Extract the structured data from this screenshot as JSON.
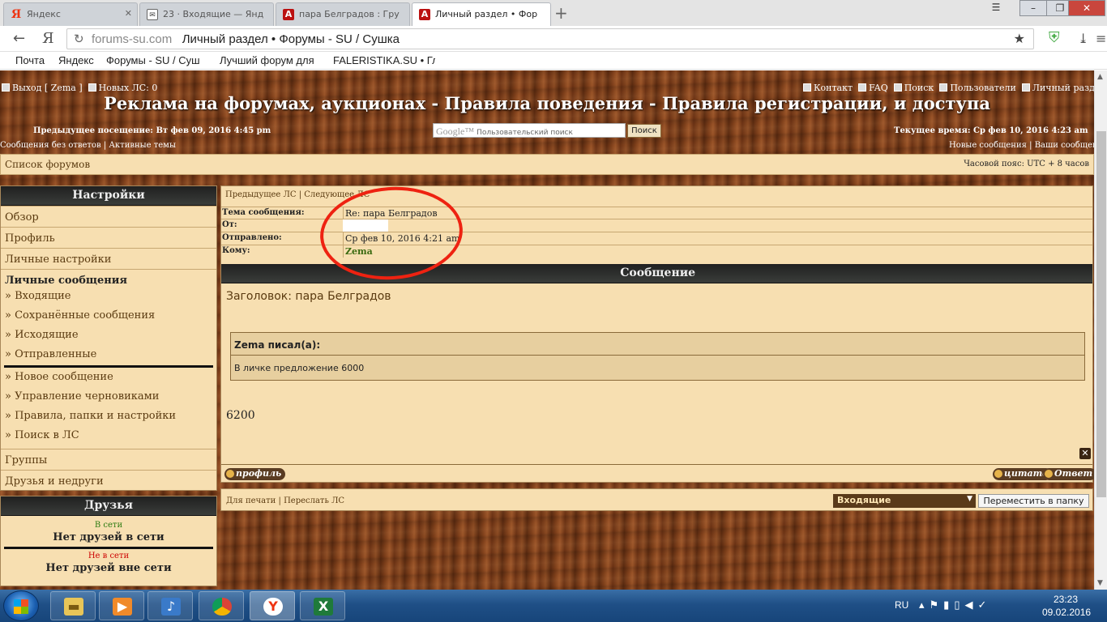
{
  "browser": {
    "tabs": [
      {
        "label": "Яндекс",
        "favicon": "yandex-icon"
      },
      {
        "label": "23 · Входящие — Янд",
        "favicon": "mail-icon"
      },
      {
        "label": "пара Белградов : Гру",
        "favicon": "forum-icon"
      },
      {
        "label": "Личный раздел • Фор",
        "favicon": "forum-icon",
        "active": true
      }
    ],
    "url_domain": "forums-su.com",
    "url_title": "Личный раздел • Форумы - SU / Сушка",
    "shield_badge": "4",
    "bookmarks": [
      "Почта",
      "Яндекс",
      "Форумы - SU / Суш",
      "Лучший форум для",
      "FALERISTIKA.SU • Гл"
    ]
  },
  "forum": {
    "top_left_logout": "Выход [ Zema ]",
    "top_left_pm": "Новых ЛС: 0",
    "top_right_links": [
      "Контакт",
      "FAQ",
      "Поиск",
      "Пользователи",
      "Личный раздел"
    ],
    "banner": "Реклама на форумах, аукционах - Правила поведения - Правила регистрации, и доступа",
    "last_visit": "Предыдущее посещение: Вт фев 09, 2016 4:45 pm",
    "current_time": "Текущее время: Ср фев 10, 2016 4:23 am",
    "search_brand": "Google™",
    "search_placeholder": "Пользовательский поиск",
    "search_button": "Поиск",
    "left_links": [
      "Сообщения без ответов",
      "Активные темы"
    ],
    "right_links": [
      "Новые сообщения",
      "Ваши сообщения"
    ],
    "forum_list": "Список форумов",
    "timezone": "Часовой пояс: UTC + 8 часов"
  },
  "nav": {
    "title": "Настройки",
    "items": [
      "Обзор",
      "Профиль",
      "Личные настройки"
    ],
    "pm_title": "Личные сообщения",
    "pm_items_a": [
      "» Входящие",
      "» Сохранённые сообщения",
      "» Исходящие",
      "» Отправленные"
    ],
    "pm_items_b": [
      "» Новое сообщение",
      "» Управление черновиками",
      "» Правила, папки и настройки",
      "» Поиск в ЛС"
    ],
    "groups": "Группы",
    "friends_foes": "Друзья и недруги"
  },
  "friends": {
    "title": "Друзья",
    "online_label": "В сети",
    "online_text": "Нет друзей в сети",
    "offline_label": "Не в сети",
    "offline_text": "Нет друзей вне сети"
  },
  "message": {
    "prev": "Предыдущее ЛС",
    "next": "Следующее ЛС",
    "subject_label": "Тема сообщения:",
    "subject": "Re: пара Белградов",
    "from_label": "От:",
    "from": "",
    "sent_label": "Отправлено:",
    "sent": "Ср фев 10, 2016 4:21 am",
    "to_label": "Кому:",
    "to": "Zema",
    "header": "Сообщение",
    "title": "Заголовок: пара Белградов",
    "quote_author": "Zema писал(а):",
    "quote_text": "В личке предложение 6000",
    "body": "6200",
    "profile_btn": "профиль",
    "quote_btn": "цитата",
    "reply_btn": "Ответ",
    "print": "Для печати",
    "forward": "Переслать ЛС",
    "folder_select": "Входящие",
    "move_btn": "Переместить в папку"
  },
  "taskbar": {
    "lang": "RU",
    "time": "23:23",
    "date": "09.02.2016"
  }
}
